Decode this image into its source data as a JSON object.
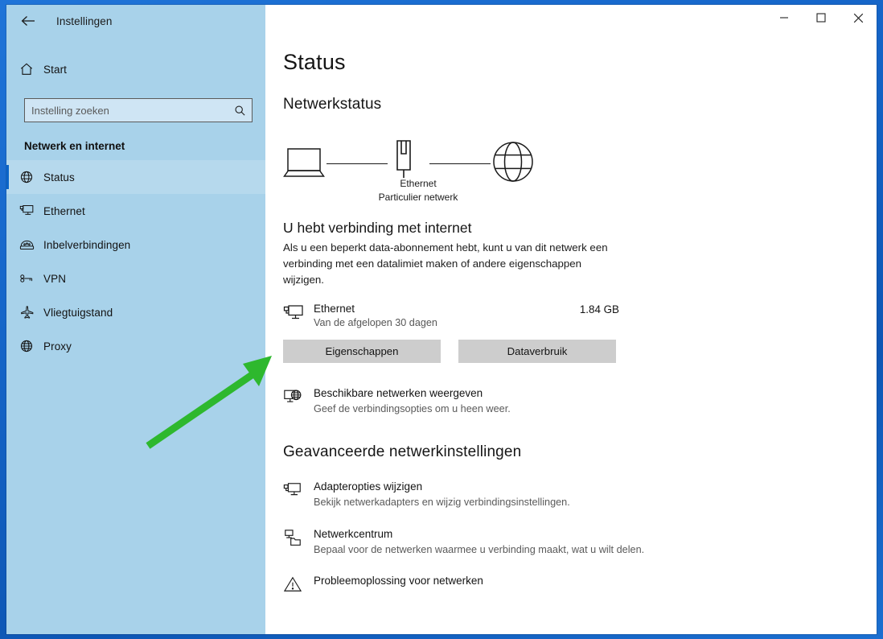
{
  "window": {
    "title": "Instellingen",
    "back_icon": "back-arrow-icon",
    "minimize_label": "–",
    "maximize_label": "□",
    "close_label": "✕"
  },
  "sidebar": {
    "home_label": "Start",
    "home_icon": "home-icon",
    "search": {
      "placeholder": "Instelling zoeken",
      "value": "",
      "icon": "search-icon"
    },
    "group_title": "Netwerk en internet",
    "items": [
      {
        "label": "Status",
        "icon": "globe-icon",
        "selected": true
      },
      {
        "label": "Ethernet",
        "icon": "monitor-network-icon",
        "selected": false
      },
      {
        "label": "Inbelverbindingen",
        "icon": "dial-up-phone-icon",
        "selected": false
      },
      {
        "label": "VPN",
        "icon": "vpn-key-icon",
        "selected": false
      },
      {
        "label": "Vliegtuigstand",
        "icon": "airplane-icon",
        "selected": false
      },
      {
        "label": "Proxy",
        "icon": "globe-grid-icon",
        "selected": false
      }
    ]
  },
  "content": {
    "page_title": "Status",
    "network_status_heading": "Netwerkstatus",
    "netmap": {
      "device_icon": "laptop-icon",
      "link_icon": "ethernet-plug-icon",
      "internet_icon": "globe-icon",
      "caption_line1": "Ethernet",
      "caption_line2": "Particulier netwerk"
    },
    "connection": {
      "title": "U hebt verbinding met internet",
      "description": "Als u een beperkt data-abonnement hebt, kunt u van dit netwerk een verbinding met een datalimiet maken of andere eigenschappen wijzigen."
    },
    "usage": {
      "icon": "monitor-network-icon",
      "name": "Ethernet",
      "subtitle": "Van de afgelopen 30 dagen",
      "value": "1.84 GB"
    },
    "buttons": {
      "properties": "Eigenschappen",
      "data_usage": "Dataverbruik"
    },
    "available_networks": {
      "icon": "monitor-globe-icon",
      "title": "Beschikbare netwerken weergeven",
      "subtitle": "Geef de verbindingsopties om u heen weer."
    },
    "advanced_heading": "Geavanceerde netwerkinstellingen",
    "advanced_items": [
      {
        "icon": "monitor-network-icon",
        "title": "Adapteropties wijzigen",
        "subtitle": "Bekijk netwerkadapters en wijzig verbindingsinstellingen."
      },
      {
        "icon": "network-sharing-icon",
        "title": "Netwerkcentrum",
        "subtitle": "Bepaal voor de netwerken waarmee u verbinding maakt, wat u wilt delen."
      },
      {
        "icon": "warning-triangle-icon",
        "title": "Probleemoplossing voor netwerken",
        "subtitle": ""
      }
    ]
  },
  "annotation": {
    "arrow_color": "#2eb82e",
    "arrow_icon": "green-pointer-arrow-icon",
    "points_to": "Eigenschappen"
  },
  "colors": {
    "window_frame_blue": "#1565c8",
    "sidebar_blue": "#a8d2ea",
    "accent_blue": "#0a64c8",
    "button_gray": "#cdcdcd",
    "annotation_green": "#2eb82e"
  }
}
